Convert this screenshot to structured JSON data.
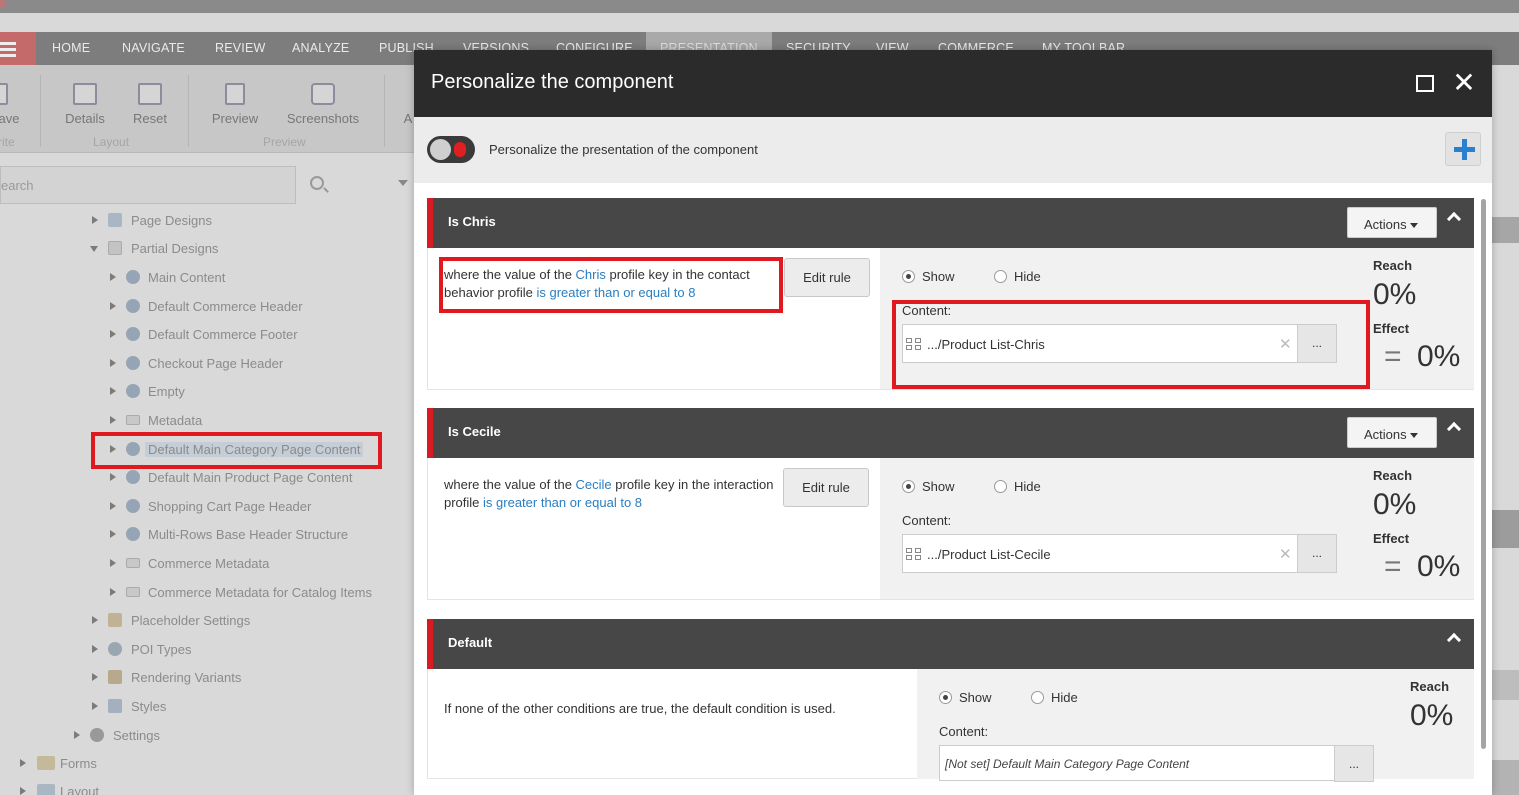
{
  "ribbon": {
    "tabs": [
      "HOME",
      "NAVIGATE",
      "REVIEW",
      "ANALYZE",
      "PUBLISH",
      "VERSIONS",
      "CONFIGURE",
      "PRESENTATION",
      "SECURITY",
      "VIEW",
      "COMMERCE",
      "MY TOOLBAR"
    ],
    "active_tab": "PRESENTATION",
    "buttons": {
      "save": "ave",
      "details": "Details",
      "reset": "Reset",
      "preview": "Preview",
      "screenshots": "Screenshots",
      "cut_label": "A"
    },
    "groups": {
      "write": "rite",
      "layout": "Layout",
      "preview": "Preview"
    }
  },
  "search": {
    "placeholder": "earch"
  },
  "tree": {
    "items": [
      "Page Designs",
      "Partial Designs",
      "Main Content",
      "Default Commerce Header",
      "Default Commerce Footer",
      "Checkout Page Header",
      "Empty",
      "Metadata",
      "Default Main Category Page Content",
      "Default Main Product Page Content",
      "Shopping Cart Page Header",
      "Multi-Rows Base Header Structure",
      "Commerce Metadata",
      "Commerce Metadata for Catalog Items",
      "Placeholder Settings",
      "POI Types",
      "Rendering Variants",
      "Styles",
      "Settings",
      "Forms",
      "Layout"
    ]
  },
  "modal": {
    "title": "Personalize the component",
    "toggle_text": "Personalize the presentation of the component",
    "rules": [
      {
        "name": "Is Chris",
        "actions_label": "Actions",
        "text_1": "where the value of the ",
        "link_1": "Chris",
        "text_2": " profile key in the contact behavior profile ",
        "link_2": "is greater than or equal to 8",
        "edit_label": "Edit rule",
        "show_label": "Show",
        "hide_label": "Hide",
        "content_label": "Content:",
        "content_value": ".../Product List-Chris",
        "more_label": "...",
        "reach_label": "Reach",
        "reach_value": "0%",
        "effect_label": "Effect",
        "effect_eq": "=",
        "effect_value": "0%"
      },
      {
        "name": "Is Cecile",
        "actions_label": "Actions",
        "text_1": "where the value of the ",
        "link_1": "Cecile",
        "text_2": " profile key in the interaction profile ",
        "link_2": "is greater than or equal to 8",
        "edit_label": "Edit rule",
        "show_label": "Show",
        "hide_label": "Hide",
        "content_label": "Content:",
        "content_value": ".../Product List-Cecile",
        "more_label": "...",
        "reach_label": "Reach",
        "reach_value": "0%",
        "effect_label": "Effect",
        "effect_eq": "=",
        "effect_value": "0%"
      }
    ],
    "default_rule": {
      "name": "Default",
      "text": "If none of the other conditions are true, the default condition is used.",
      "show_label": "Show",
      "hide_label": "Hide",
      "content_label": "Content:",
      "content_value": "[Not set] Default Main Category Page Content",
      "more_label": "...",
      "reach_label": "Reach",
      "reach_value": "0%"
    }
  },
  "colors": {
    "accent_red": "#d61b22",
    "link_blue": "#2a7ec1",
    "header_dark": "#2b2b2b",
    "rule_header": "#474747"
  }
}
